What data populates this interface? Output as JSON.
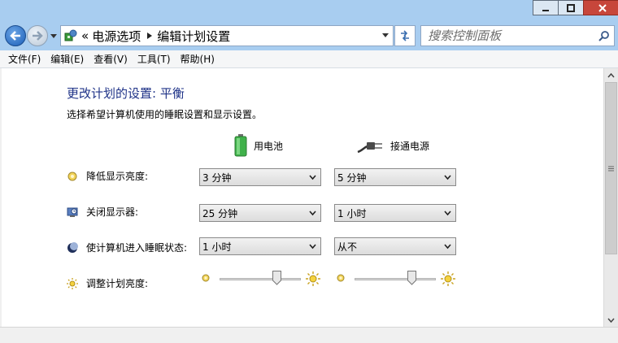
{
  "address": {
    "overflow_chevron": "«",
    "crumbs": [
      "电源选项",
      "编辑计划设置"
    ]
  },
  "search": {
    "placeholder": "搜索控制面板"
  },
  "menu": [
    "文件(F)",
    "编辑(E)",
    "查看(V)",
    "工具(T)",
    "帮助(H)"
  ],
  "page": {
    "title": "更改计划的设置: 平衡",
    "subtitle": "选择希望计算机使用的睡眠设置和显示设置。"
  },
  "columns": {
    "battery": "用电池",
    "plugged": "接通电源"
  },
  "rows": [
    {
      "label": "降低显示亮度:",
      "icon": "dim-brightness-icon",
      "battery": "3 分钟",
      "plugged": "5 分钟"
    },
    {
      "label": "关闭显示器:",
      "icon": "monitor-clock-icon",
      "battery": "25 分钟",
      "plugged": "1 小时"
    },
    {
      "label": "使计算机进入睡眠状态:",
      "icon": "sleep-moon-icon",
      "battery": "1 小时",
      "plugged": "从不"
    }
  ],
  "brightness": {
    "label": "调整计划亮度:",
    "battery_level": 0.7,
    "plugged_level": 0.7
  },
  "colors": {
    "title_blue": "#1e3287",
    "chrome": "#a8cdf0"
  }
}
